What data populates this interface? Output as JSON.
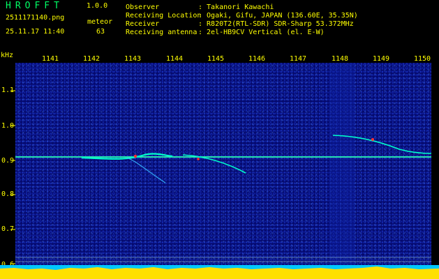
{
  "app": {
    "title": "HROFFT",
    "version": "1.0.0"
  },
  "capture": {
    "filename": "2511171140.png",
    "datetime": "25.11.17 11:40",
    "meteor_label": "meteor",
    "meteor_count": "63"
  },
  "info": [
    {
      "key": "Observer",
      "value": ": Takanori Kawachi"
    },
    {
      "key": "Receiving Location",
      "value": ": Ogaki, Gifu, JAPAN (136.60E, 35.35N)"
    },
    {
      "key": "Receiver",
      "value": ": R820T2(RTL-SDR) SDR-Sharp 53.372MHz"
    },
    {
      "key": "Receiving antenna",
      "value": ": 2el-HB9CV Vertical (el. E-W)"
    }
  ],
  "axes": {
    "y_unit": "kHz",
    "time_ticks": [
      "1141",
      "1142",
      "1143",
      "1144",
      "1145",
      "1146",
      "1147",
      "1148",
      "1149",
      "1150"
    ],
    "freq_ticks": [
      "1.1",
      "1.0",
      "0.9",
      "0.8",
      "0.7",
      "0.6"
    ]
  },
  "colors": {
    "label": "#ffff00",
    "title": "#00ff66",
    "background": "#050a6e",
    "signal": "#00ffcc",
    "hot": "#ff3030",
    "bottom": "#00c8ff",
    "level": "#ffe000"
  }
}
